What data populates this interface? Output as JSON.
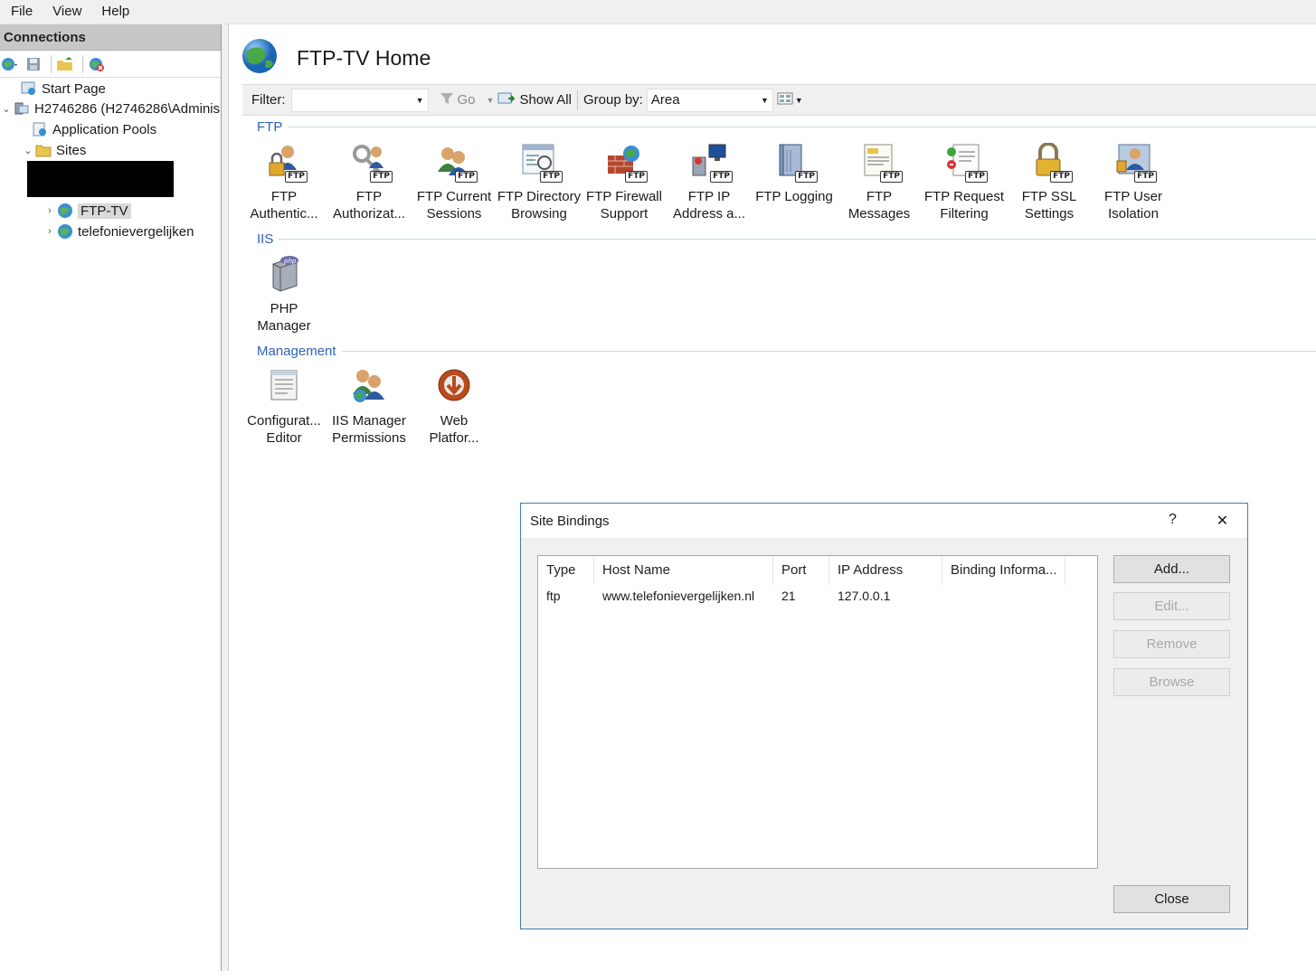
{
  "menubar": {
    "items": [
      "File",
      "View",
      "Help"
    ]
  },
  "connections": {
    "header": "Connections",
    "tree": {
      "start_page": "Start Page",
      "server": "H2746286 (H2746286\\Adminis",
      "app_pools": "Application Pools",
      "sites": "Sites",
      "site_ftp": "FTP-TV",
      "site_other": "telefonievergelijken"
    }
  },
  "main": {
    "title": "FTP-TV Home",
    "filter": {
      "label": "Filter:",
      "value": "",
      "go_label": "Go",
      "show_all_label": "Show All",
      "group_by_label": "Group by:",
      "group_by_value": "Area"
    },
    "sections": {
      "ftp": "FTP",
      "iis": "IIS",
      "management": "Management"
    },
    "ftp_features": [
      {
        "line1": "FTP",
        "line2": "Authentic...",
        "icon": "lock-user-icon"
      },
      {
        "line1": "FTP",
        "line2": "Authorizat...",
        "icon": "key-icon"
      },
      {
        "line1": "FTP Current",
        "line2": "Sessions",
        "icon": "users-icon"
      },
      {
        "line1": "FTP Directory",
        "line2": "Browsing",
        "icon": "browse-icon"
      },
      {
        "line1": "FTP Firewall",
        "line2": "Support",
        "icon": "firewall-icon"
      },
      {
        "line1": "FTP IP",
        "line2": "Address a...",
        "icon": "ip-monitor-icon"
      },
      {
        "line1": "FTP Logging",
        "line2": "",
        "icon": "logbook-icon"
      },
      {
        "line1": "FTP",
        "line2": "Messages",
        "icon": "message-doc-icon"
      },
      {
        "line1": "FTP Request",
        "line2": "Filtering",
        "icon": "filter-doc-icon"
      },
      {
        "line1": "FTP SSL",
        "line2": "Settings",
        "icon": "padlock-icon"
      },
      {
        "line1": "FTP User",
        "line2": "Isolation",
        "icon": "user-isolation-icon"
      }
    ],
    "iis_features": [
      {
        "line1": "PHP",
        "line2": "Manager",
        "icon": "php-server-icon"
      }
    ],
    "management_features": [
      {
        "line1": "Configurat...",
        "line2": "Editor",
        "icon": "config-doc-icon"
      },
      {
        "line1": "IIS Manager",
        "line2": "Permissions",
        "icon": "users-permissions-icon"
      },
      {
        "line1": "Web",
        "line2": "Platfor...",
        "icon": "web-platform-icon"
      }
    ]
  },
  "dialog": {
    "title": "Site Bindings",
    "help": "?",
    "close_glyph": "✕",
    "columns": [
      "Type",
      "Host Name",
      "Port",
      "IP Address",
      "Binding Informa..."
    ],
    "rows": [
      [
        "ftp",
        "www.telefonievergelijken.nl",
        "21",
        "127.0.0.1",
        ""
      ]
    ],
    "buttons": {
      "add": "Add...",
      "edit": "Edit...",
      "remove": "Remove",
      "browse": "Browse",
      "close": "Close"
    }
  },
  "colors": {
    "section_title": "#3063b6",
    "dialog_border": "#3c7fb1",
    "connections_header": "#c7c7c7"
  }
}
